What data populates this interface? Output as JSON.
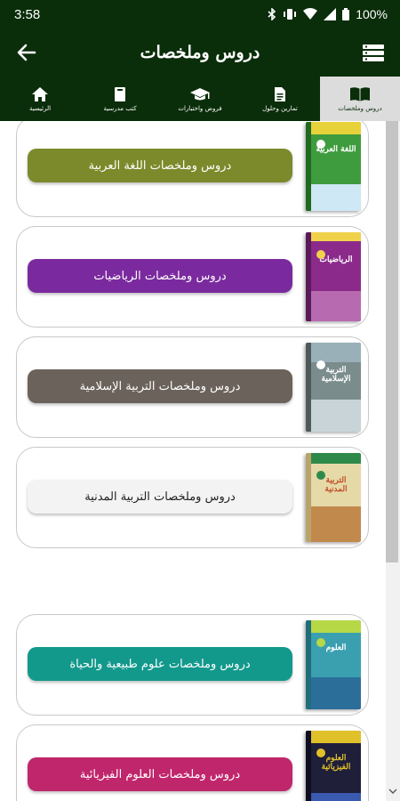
{
  "status": {
    "time": "3:58",
    "battery": "100%"
  },
  "appbar": {
    "title": "دروس وملخصات"
  },
  "tabs": [
    {
      "label": "الرئيسية",
      "icon": "home-icon",
      "active": false
    },
    {
      "label": "كتب مدرسية",
      "icon": "book-icon",
      "active": false
    },
    {
      "label": "فروض واختبارات",
      "icon": "graduation-cap-icon",
      "active": false
    },
    {
      "label": "تمارين وحلول",
      "icon": "document-icon",
      "active": false
    },
    {
      "label": "دروس وملخصات",
      "icon": "open-book-icon",
      "active": true
    }
  ],
  "subjects": [
    {
      "label": "دروس وملخصات اللغة العربية",
      "color": "#7c8a2b",
      "text_color": "#ffffff",
      "cover_title": "اللغة العربية",
      "cover_color": "#3e9c3e",
      "cover_accent": "#e8d23a"
    },
    {
      "label": "دروس وملخصات الرياضيات",
      "color": "#7a2a9e",
      "text_color": "#ffffff",
      "cover_title": "الرياضيات",
      "cover_color": "#8c2a8c",
      "cover_accent": "#f0d24a"
    },
    {
      "label": "دروس وملخصات التربية الإسلامية",
      "color": "#6b635b",
      "text_color": "#ffffff",
      "cover_title": "التربية الإسلامية",
      "cover_color": "#7b8c8c",
      "cover_accent": "#9ab0b8"
    },
    {
      "label": "دروس وملخصات التربية المدنية",
      "color": "#f3f3f3",
      "text_color": "#222222",
      "cover_title": "التربية المدنية",
      "cover_color": "#e6d9a8",
      "cover_accent": "#c2512c"
    },
    {
      "label": "دروس وملخصات علوم طبيعية والحياة",
      "color": "#12998c",
      "text_color": "#ffffff",
      "cover_title": "العلوم",
      "cover_color": "#3aa0b0",
      "cover_accent": "#b6d847"
    },
    {
      "label": "دروس وملخصات العلوم الفيزيائية",
      "color": "#c0266c",
      "text_color": "#ffffff",
      "cover_title": "العلوم الفيزيائية",
      "cover_color": "#1f1f3a",
      "cover_accent": "#e0c12a"
    }
  ]
}
